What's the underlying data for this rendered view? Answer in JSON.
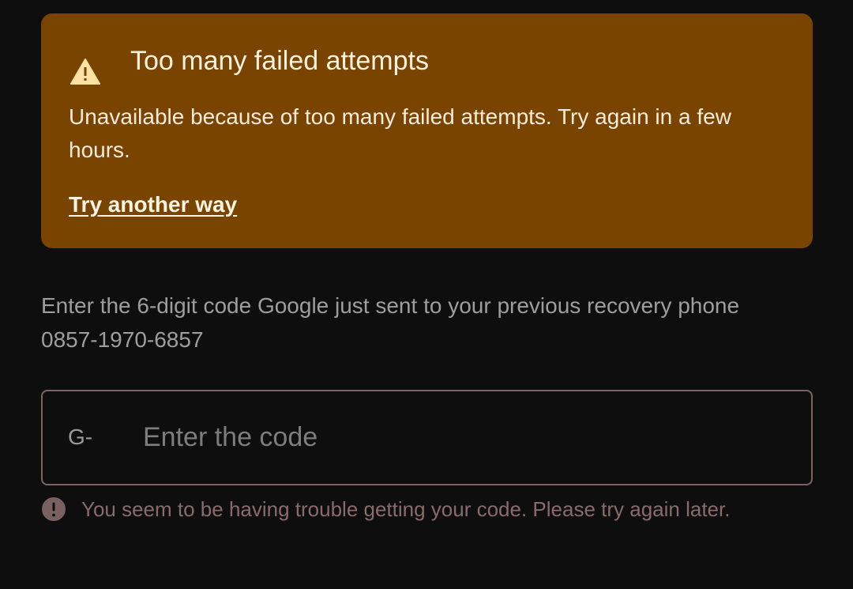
{
  "alert": {
    "icon": "warning-icon",
    "title": "Too many failed attempts",
    "body": "Unavailable because of too many failed attempts. Try again in a few hours.",
    "link_label": "Try another way"
  },
  "instruction": "Enter the 6-digit code Google just sent to your previous recovery phone 0857-1970-6857",
  "code_field": {
    "prefix": "G-",
    "placeholder": "Enter the code",
    "value": ""
  },
  "error": {
    "icon": "error-icon",
    "text": "You seem to be having trouble getting your code. Please try again later."
  },
  "colors": {
    "background": "#0e0e0e",
    "alert_background": "#794400",
    "alert_text": "#f8ebdc",
    "instruction_text": "#9e9e9e",
    "field_border": "#7d6464",
    "error_text": "#8a6b6b"
  }
}
